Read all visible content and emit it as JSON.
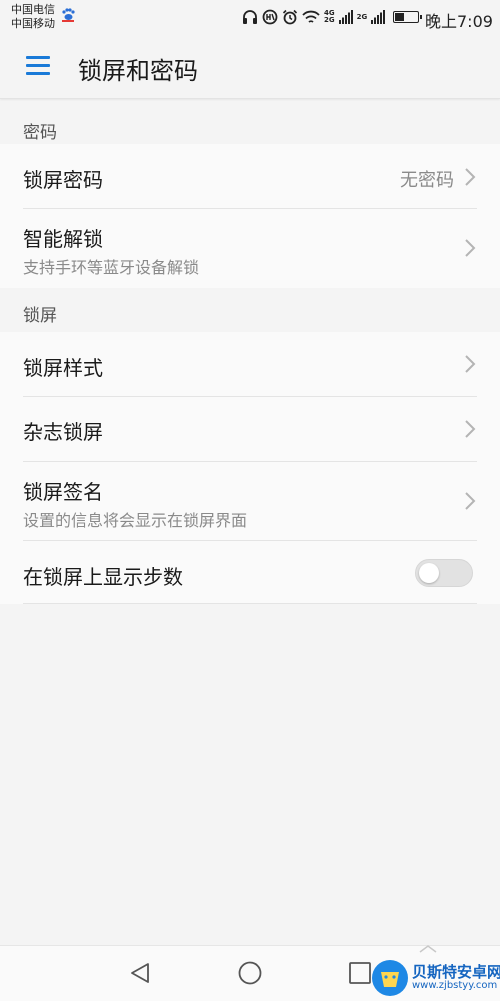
{
  "status_bar": {
    "carrier_1": "中国电信",
    "carrier_2": "中国移动",
    "network_1": "4G",
    "network_2": "2G",
    "battery_percent": 45,
    "time": "晚上7:09"
  },
  "header": {
    "title": "锁屏和密码",
    "menu_icon": "hamburger-menu-icon",
    "accent_color": "#1a7ad8"
  },
  "sections": [
    {
      "header": "密码",
      "items": [
        {
          "title": "锁屏密码",
          "value": "无密码"
        },
        {
          "title": "智能解锁",
          "subtitle": "支持手环等蓝牙设备解锁"
        }
      ]
    },
    {
      "header": "锁屏",
      "items": [
        {
          "title": "锁屏样式"
        },
        {
          "title": "杂志锁屏"
        },
        {
          "title": "锁屏签名",
          "subtitle": "设置的信息将会显示在锁屏界面"
        },
        {
          "title": "在锁屏上显示步数",
          "toggle": false
        }
      ]
    }
  ],
  "nav_bar": {
    "back_icon": "back-triangle-icon",
    "home_icon": "home-circle-icon",
    "recents_icon": "recents-square-icon"
  },
  "watermark": {
    "text": "贝斯特安卓网",
    "url": "www.zjbstyy.com"
  }
}
